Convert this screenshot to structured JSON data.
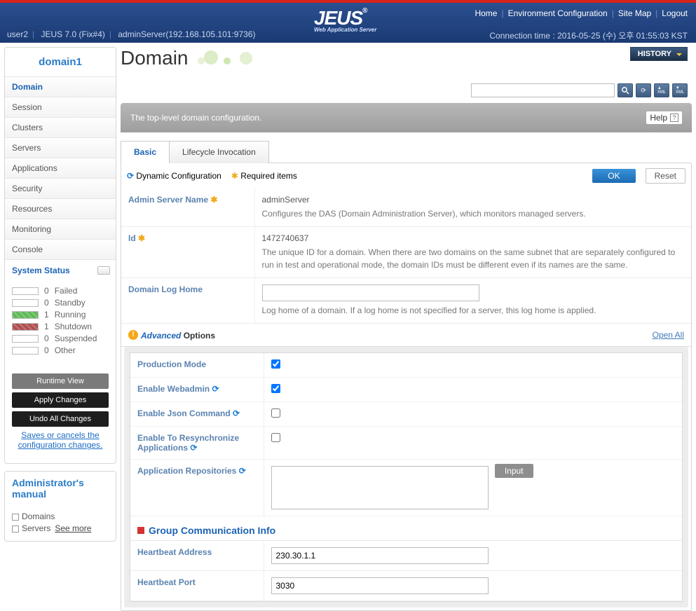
{
  "header": {
    "links": [
      "Home",
      "Environment Configuration",
      "Site Map",
      "Logout"
    ],
    "user": "user2",
    "version": "JEUS 7.0 (Fix#4)",
    "server": "adminServer(192.168.105.101:9736)",
    "conn": "Connection time : 2016-05-25 (수) 오후 01:55:03 KST",
    "logo": "JEUS",
    "logo_tm": "®",
    "logo_sub": "Web Application Server"
  },
  "sidebar": {
    "domain": "domain1",
    "nav": [
      "Domain",
      "Session",
      "Clusters",
      "Servers",
      "Applications",
      "Security",
      "Resources",
      "Monitoring",
      "Console"
    ],
    "sys_title": "System Status",
    "status": [
      {
        "cls": "",
        "n": "0",
        "l": "Failed"
      },
      {
        "cls": "",
        "n": "0",
        "l": "Standby"
      },
      {
        "cls": "green",
        "n": "1",
        "l": "Running"
      },
      {
        "cls": "red",
        "n": "1",
        "l": "Shutdown"
      },
      {
        "cls": "",
        "n": "0",
        "l": "Suspended"
      },
      {
        "cls": "",
        "n": "0",
        "l": "Other"
      }
    ],
    "runtime": "Runtime View",
    "apply": "Apply Changes",
    "undo": "Undo All Changes",
    "save_text": "Saves or cancels the configuration changes.",
    "manual": "Administrator's manual",
    "domains": "Domains",
    "servers": "Servers",
    "seemore": "See more"
  },
  "content": {
    "title": "Domain",
    "history": "HISTORY",
    "banner": "The top-level domain configuration.",
    "help": "Help",
    "tabs": [
      "Basic",
      "Lifecycle Invocation"
    ],
    "dyn": "Dynamic Configuration",
    "req": "Required items",
    "ok": "OK",
    "reset": "Reset",
    "rows": [
      {
        "label": "Admin Server Name",
        "req": true,
        "value": "adminServer",
        "desc": "Configures the DAS (Domain Administration Server), which monitors managed servers."
      },
      {
        "label": "Id",
        "req": true,
        "value": "1472740637",
        "desc": "The unique ID for a domain. When there are two domains on the same subnet that are separately configured to run in test and operational mode, the domain IDs must be different even if its names are the same."
      },
      {
        "label": "Domain Log Home",
        "req": false,
        "input": "",
        "desc": "Log home of a domain. If a log home is not specified for a server, this log home is applied."
      }
    ],
    "adv": {
      "title": "Advanced",
      "opt": " Options",
      "open": "Open All",
      "items": [
        {
          "label": "Production Mode",
          "type": "check",
          "checked": true,
          "dyn": false
        },
        {
          "label": "Enable Webadmin",
          "type": "check",
          "checked": true,
          "dyn": true
        },
        {
          "label": "Enable Json Command",
          "type": "check",
          "checked": false,
          "dyn": true
        },
        {
          "label": "Enable To Resynchronize Applications",
          "type": "check",
          "checked": false,
          "dyn": true
        },
        {
          "label": "Application Repositories",
          "type": "textarea",
          "dyn": true,
          "btn": "Input"
        }
      ],
      "group": "Group Communication Info",
      "group_rows": [
        {
          "label": "Heartbeat Address",
          "value": "230.30.1.1"
        },
        {
          "label": "Heartbeat Port",
          "value": "3030"
        }
      ]
    }
  }
}
